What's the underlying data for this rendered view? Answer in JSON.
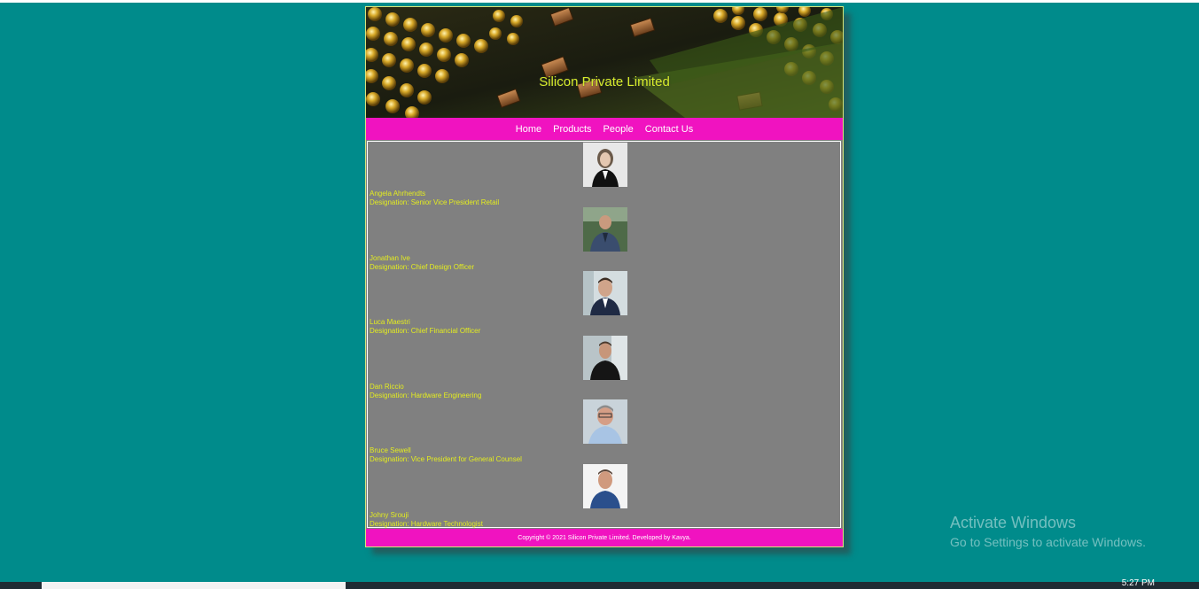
{
  "site": {
    "title": "Silicon Private Limited",
    "colors": {
      "page_background": "#008b8b",
      "nav_background": "#f013c0",
      "content_background": "#808080",
      "accent_text": "#e3ec20"
    }
  },
  "nav": {
    "items": [
      {
        "label": "Home"
      },
      {
        "label": "Products"
      },
      {
        "label": "People"
      },
      {
        "label": "Contact Us"
      }
    ]
  },
  "people": [
    {
      "name": "Angela Ahrhendts",
      "designation": "Designation: Senior Vice President Retail"
    },
    {
      "name": "Jonathan Ive",
      "designation": "Designation: Chief Design Officer"
    },
    {
      "name": "Luca Maestri",
      "designation": "Designation: Chief Financial Officer"
    },
    {
      "name": "Dan Riccio",
      "designation": "Designation: Hardware Engineering"
    },
    {
      "name": "Bruce Sewell",
      "designation": "Designation: Vice President for General Counsel"
    },
    {
      "name": "Johny Srouji",
      "designation": "Designation: Hardware Technologist"
    }
  ],
  "footer": {
    "text": "Copyright © 2021 Silicon Private Limited. Developed by Kavya."
  },
  "os": {
    "watermark_title": "Activate Windows",
    "watermark_subtitle": "Go to Settings to activate Windows.",
    "clock": "5:27 PM"
  }
}
